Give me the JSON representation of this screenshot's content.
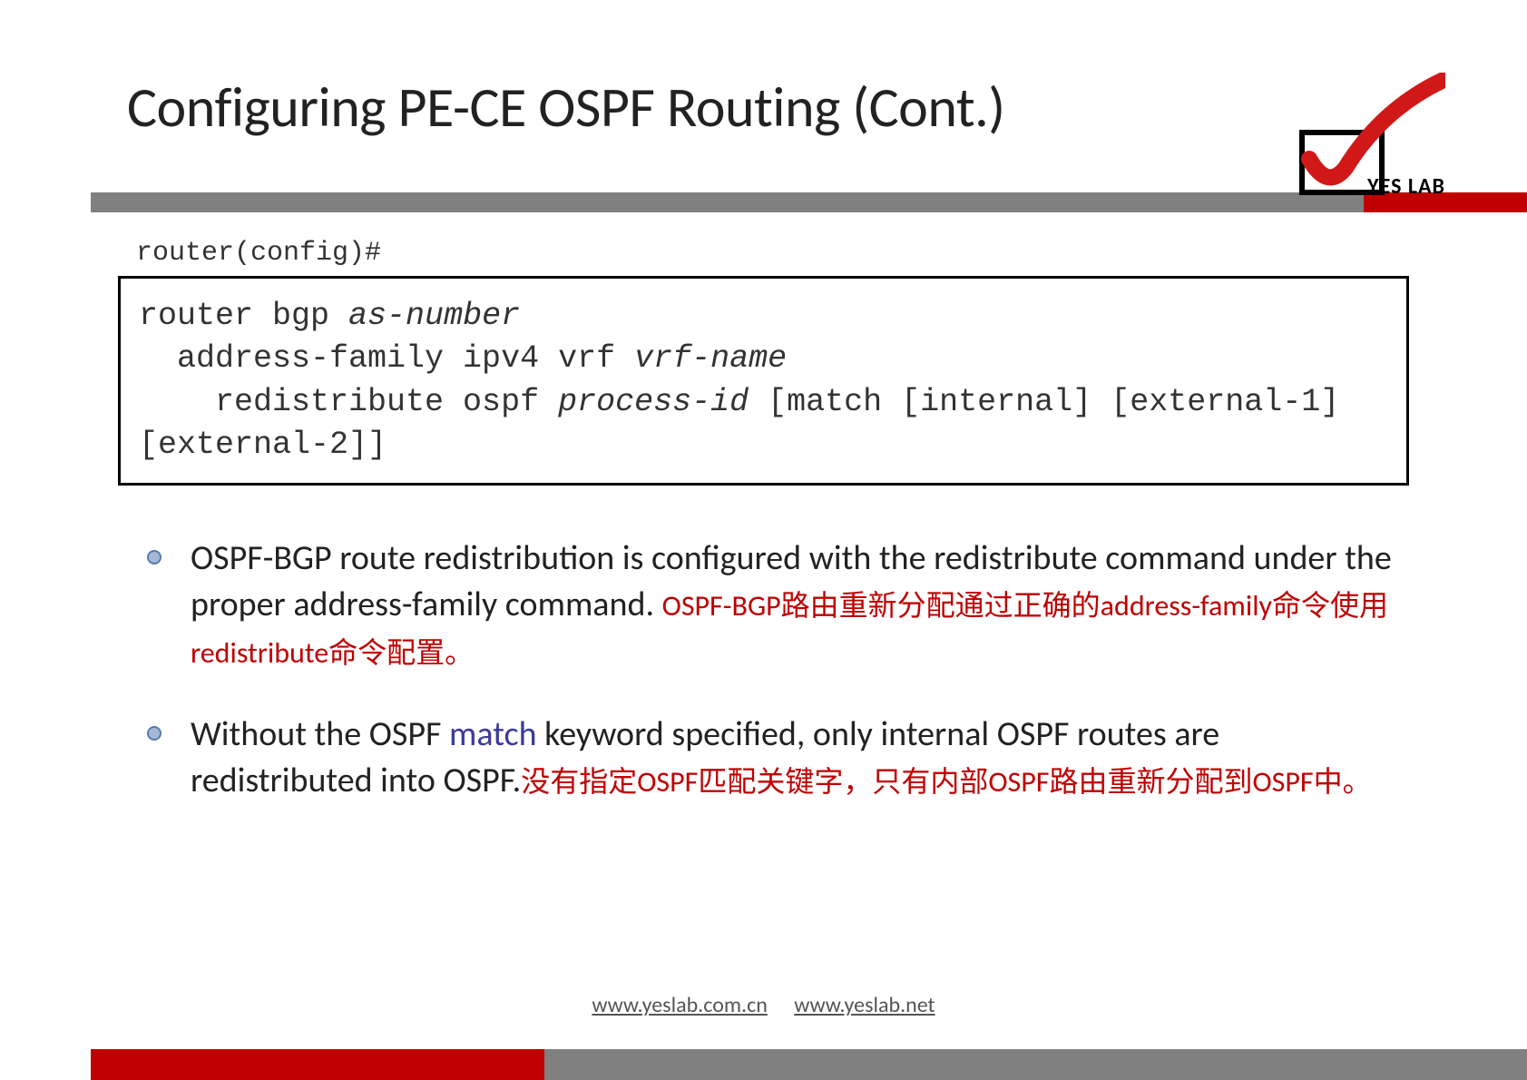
{
  "title": "Configuring PE-CE OSPF Routing (Cont.)",
  "logo": {
    "text": "YES LAB"
  },
  "prompt": "router(config)#",
  "code": {
    "line1_pre": "router bgp ",
    "line1_italic": "as-number",
    "line2_pre": "  address-family ipv4 vrf ",
    "line2_italic": "vrf-name",
    "line3_pre": "    redistribute ospf ",
    "line3_italic": "process-id",
    "line3_post": " [match [internal] [external-1] [external-2]]"
  },
  "bullets": {
    "b1_main": "OSPF-BGP route redistribution is configured with the redistribute command under the proper address-family command. ",
    "b1_red": "OSPF-BGP路由重新分配通过正确的address-family命令使用redistribute命令配置。",
    "b2_main_a": "Without the OSPF ",
    "b2_main_purple": "match",
    "b2_main_b": " keyword specified, only internal OSPF routes are redistributed into OSPF.",
    "b2_red": "没有指定OSPF匹配关键字，只有内部OSPF路由重新分配到OSPF中。"
  },
  "footer": {
    "link1": "www.yeslab.com.cn",
    "link2": "www.yeslab.net"
  },
  "colors": {
    "accent_red": "#c00000",
    "accent_gray": "#808080",
    "bullet_fill": "#a6b8d6",
    "bullet_border": "#5a7aa8",
    "purple": "#3b3b9e"
  }
}
